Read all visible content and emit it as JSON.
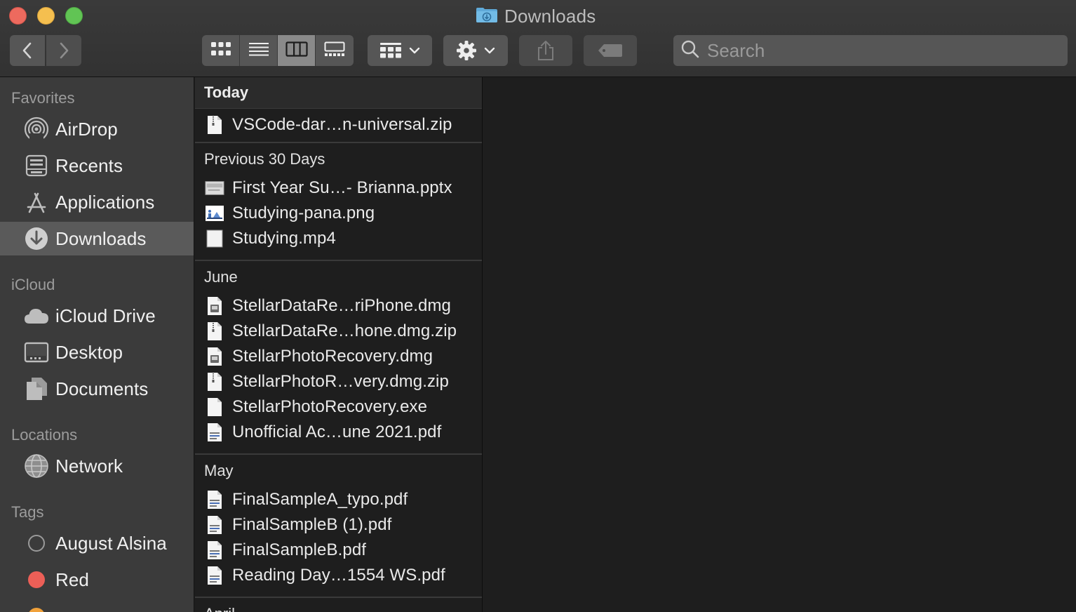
{
  "window": {
    "title": "Downloads",
    "title_icon": "downloads-folder-icon"
  },
  "toolbar": {
    "back_icon": "chevron-left-icon",
    "forward_icon": "chevron-right-icon",
    "view_modes": [
      "icon-view",
      "list-view",
      "column-view",
      "gallery-view"
    ],
    "active_view": "column-view",
    "group_icon": "group-by-icon",
    "action_icon": "gear-icon",
    "share_icon": "share-icon",
    "tag_icon": "tag-icon",
    "search_placeholder": "Search"
  },
  "sidebar": {
    "favorites_title": "Favorites",
    "favorites": [
      {
        "label": "AirDrop",
        "icon": "airdrop-icon"
      },
      {
        "label": "Recents",
        "icon": "recents-icon"
      },
      {
        "label": "Applications",
        "icon": "applications-icon"
      },
      {
        "label": "Downloads",
        "icon": "downloads-icon",
        "selected": true
      }
    ],
    "icloud_title": "iCloud",
    "icloud": [
      {
        "label": "iCloud Drive",
        "icon": "cloud-icon"
      },
      {
        "label": "Desktop",
        "icon": "desktop-icon"
      },
      {
        "label": "Documents",
        "icon": "documents-icon"
      }
    ],
    "locations_title": "Locations",
    "locations": [
      {
        "label": "Network",
        "icon": "network-globe-icon"
      }
    ],
    "tags_title": "Tags",
    "tags": [
      {
        "label": "August Alsina",
        "color": "none"
      },
      {
        "label": "Red",
        "color": "#ec5f57"
      }
    ],
    "tag_partial_color": "#f0a13a"
  },
  "column": {
    "groups": [
      {
        "title": "Today",
        "files": [
          {
            "name": "VSCode-dar…n-universal.zip",
            "icon": "zip-file-icon"
          }
        ]
      },
      {
        "title": "Previous 30 Days",
        "files": [
          {
            "name": "First Year Su…- Brianna.pptx",
            "icon": "pptx-file-icon"
          },
          {
            "name": "Studying-pana.png",
            "icon": "png-file-icon"
          },
          {
            "name": "Studying.mp4",
            "icon": "video-file-icon"
          }
        ]
      },
      {
        "title": "June",
        "files": [
          {
            "name": "StellarDataRe…riPhone.dmg",
            "icon": "dmg-file-icon"
          },
          {
            "name": "StellarDataRe…hone.dmg.zip",
            "icon": "zip-file-icon"
          },
          {
            "name": "StellarPhotoRecovery.dmg",
            "icon": "dmg-file-icon"
          },
          {
            "name": "StellarPhotoR…very.dmg.zip",
            "icon": "zip-file-icon"
          },
          {
            "name": "StellarPhotoRecovery.exe",
            "icon": "generic-file-icon"
          },
          {
            "name": "Unofficial Ac…une 2021.pdf",
            "icon": "pdf-file-icon"
          }
        ]
      },
      {
        "title": "May",
        "files": [
          {
            "name": "FinalSampleA_typo.pdf",
            "icon": "pdf-file-icon"
          },
          {
            "name": "FinalSampleB (1).pdf",
            "icon": "pdf-file-icon"
          },
          {
            "name": "FinalSampleB.pdf",
            "icon": "pdf-file-icon"
          },
          {
            "name": "Reading Day…1554 WS.pdf",
            "icon": "pdf-file-icon"
          }
        ]
      },
      {
        "title": "April",
        "files": []
      }
    ]
  }
}
